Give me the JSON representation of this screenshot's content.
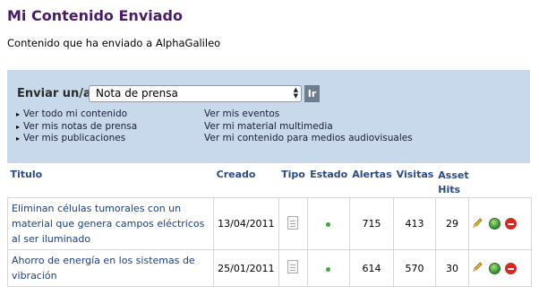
{
  "page": {
    "title": "Mi Contenido Enviado",
    "subtitle": "Contenido que ha enviado a AlphaGalileo"
  },
  "send_panel": {
    "label": "Enviar un/a",
    "select_value": "Nota de prensa",
    "go_label": "Ir",
    "links_left": [
      "Ver todo mi contenido",
      "Ver mis notas de prensa",
      "Ver mis publicaciones"
    ],
    "links_right": [
      "Ver mis eventos",
      "Ver mi material multimedia",
      "Ver mi contenido para medios audiovisuales"
    ]
  },
  "table": {
    "headers": {
      "title": "Titulo",
      "created": "Creado",
      "type": "Tipo",
      "status": "Estado",
      "alerts": "Alertas",
      "visits": "Visitas",
      "hits": "Asset Hits"
    },
    "rows": [
      {
        "title": "Eliminan células tumorales con un material que genera campos eléctricos al ser iluminado",
        "created": "13/04/2011",
        "type_icon": "document-icon",
        "status_icon": "green-dot-icon",
        "alerts": "715",
        "visits": "413",
        "hits": "29"
      },
      {
        "title": "Ahorro de energía en los sistemas de vibración",
        "created": "25/01/2011",
        "type_icon": "document-icon",
        "status_icon": "green-dot-icon",
        "alerts": "614",
        "visits": "570",
        "hits": "30"
      }
    ],
    "action_icons": [
      "edit-pencil-icon",
      "publish-globe-icon",
      "delete-icon"
    ]
  }
}
